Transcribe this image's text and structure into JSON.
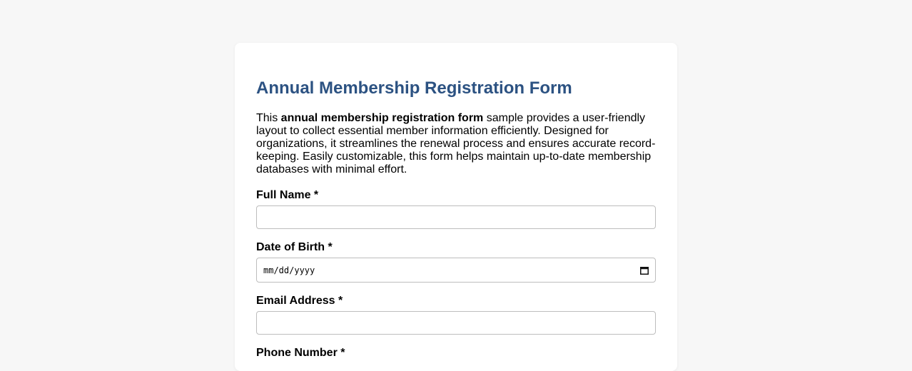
{
  "form": {
    "title": "Annual Membership Registration Form",
    "intro": {
      "before": "This ",
      "bold": "annual membership registration form",
      "after": " sample provides a user-friendly layout to collect essential member information efficiently. Designed for organizations, it streamlines the renewal process and ensures accurate record-keeping. Easily customizable, this form helps maintain up-to-date membership databases with minimal effort."
    },
    "fields": {
      "full_name": {
        "label": "Full Name *",
        "value": ""
      },
      "dob": {
        "label": "Date of Birth *",
        "placeholder": "mm/dd/yyyy",
        "icon": "calendar-icon"
      },
      "email": {
        "label": "Email Address *",
        "value": ""
      },
      "phone": {
        "label": "Phone Number *"
      }
    }
  },
  "colors": {
    "background": "#f7f7f7",
    "card": "#ffffff",
    "title": "#2c5282",
    "border": "#bdbdbd"
  }
}
